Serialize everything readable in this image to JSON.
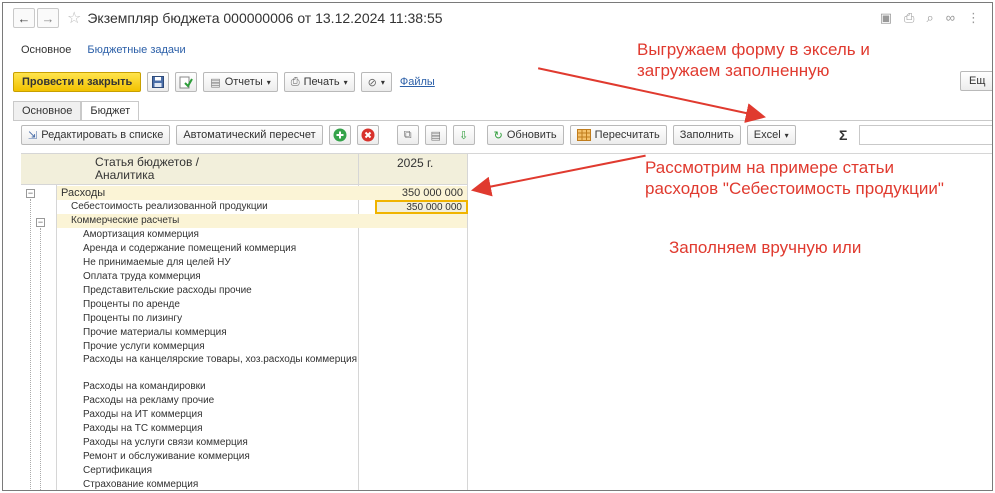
{
  "window": {
    "title": "Экземпляр бюджета 000000006 от 13.12.2024 11:38:55",
    "back_glyph": "←",
    "forward_glyph": "→",
    "star_glyph": "☆"
  },
  "section_tabs": [
    "Основное",
    "Бюджетные задачи"
  ],
  "command_bar": {
    "post_close": "Провести и закрыть",
    "reports": "Отчеты",
    "print": "Печать",
    "files": "Файлы",
    "more": "Ещ"
  },
  "form_tabs": [
    "Основное",
    "Бюджет"
  ],
  "toolbar2": {
    "edit_list": "Редактировать в списке",
    "auto_recalc": "Автоматический пересчет",
    "refresh": "Обновить",
    "recalc": "Пересчитать",
    "fill": "Заполнить",
    "excel": "Excel",
    "sigma": "Σ"
  },
  "grid": {
    "head_name_line1": "Статья бюджетов /",
    "head_name_line2": "Аналитика",
    "head_year": "2025 г.",
    "rows": [
      {
        "name": "Расходы",
        "value": "350 000 000"
      },
      {
        "name": "Себестоимость реализованной продукции",
        "value": "350 000 000"
      },
      {
        "name": "Коммерческие расчеты",
        "value": ""
      },
      {
        "name": "Амортизация коммерция",
        "value": ""
      },
      {
        "name": "Аренда и содержание помещений коммерция",
        "value": ""
      },
      {
        "name": "Не принимаемые для целей НУ",
        "value": ""
      },
      {
        "name": "Оплата труда коммерция",
        "value": ""
      },
      {
        "name": "Представительские расходы прочие",
        "value": ""
      },
      {
        "name": "Проценты по аренде",
        "value": ""
      },
      {
        "name": "Проценты по лизингу",
        "value": ""
      },
      {
        "name": "Прочие материалы коммерция",
        "value": ""
      },
      {
        "name": "Прочие услуги коммерция",
        "value": ""
      },
      {
        "name": "Расходы на канцелярские товары, хоз.расходы коммерция",
        "value": ""
      },
      {
        "name": "Расходы на командировки",
        "value": ""
      },
      {
        "name": "Расходы на рекламу прочие",
        "value": ""
      },
      {
        "name": "Раходы на ИТ коммерция",
        "value": ""
      },
      {
        "name": "Раходы на ТС коммерция",
        "value": ""
      },
      {
        "name": "Раходы на услуги связи коммерция",
        "value": ""
      },
      {
        "name": "Ремонт и обслуживание коммерция",
        "value": ""
      },
      {
        "name": "Сертификация",
        "value": ""
      },
      {
        "name": "Страхование коммерция",
        "value": ""
      }
    ]
  },
  "annotations": {
    "note1_line1": "Выгружаем форму в эксель и",
    "note1_line2": "загружаем заполненную",
    "note2_line1": "Рассмотрим на примере статьи",
    "note2_line2": "расходов \"Себестоимость продукции\"",
    "note3": "Заполняем вручную или",
    "color": "#e03a2f"
  },
  "colors": {
    "primary_button": "#f2c200",
    "header_bg": "#f2efdb",
    "group_row_bg": "#fbf4d6",
    "selection_border": "#f0b400",
    "link": "#2b5fa8"
  }
}
